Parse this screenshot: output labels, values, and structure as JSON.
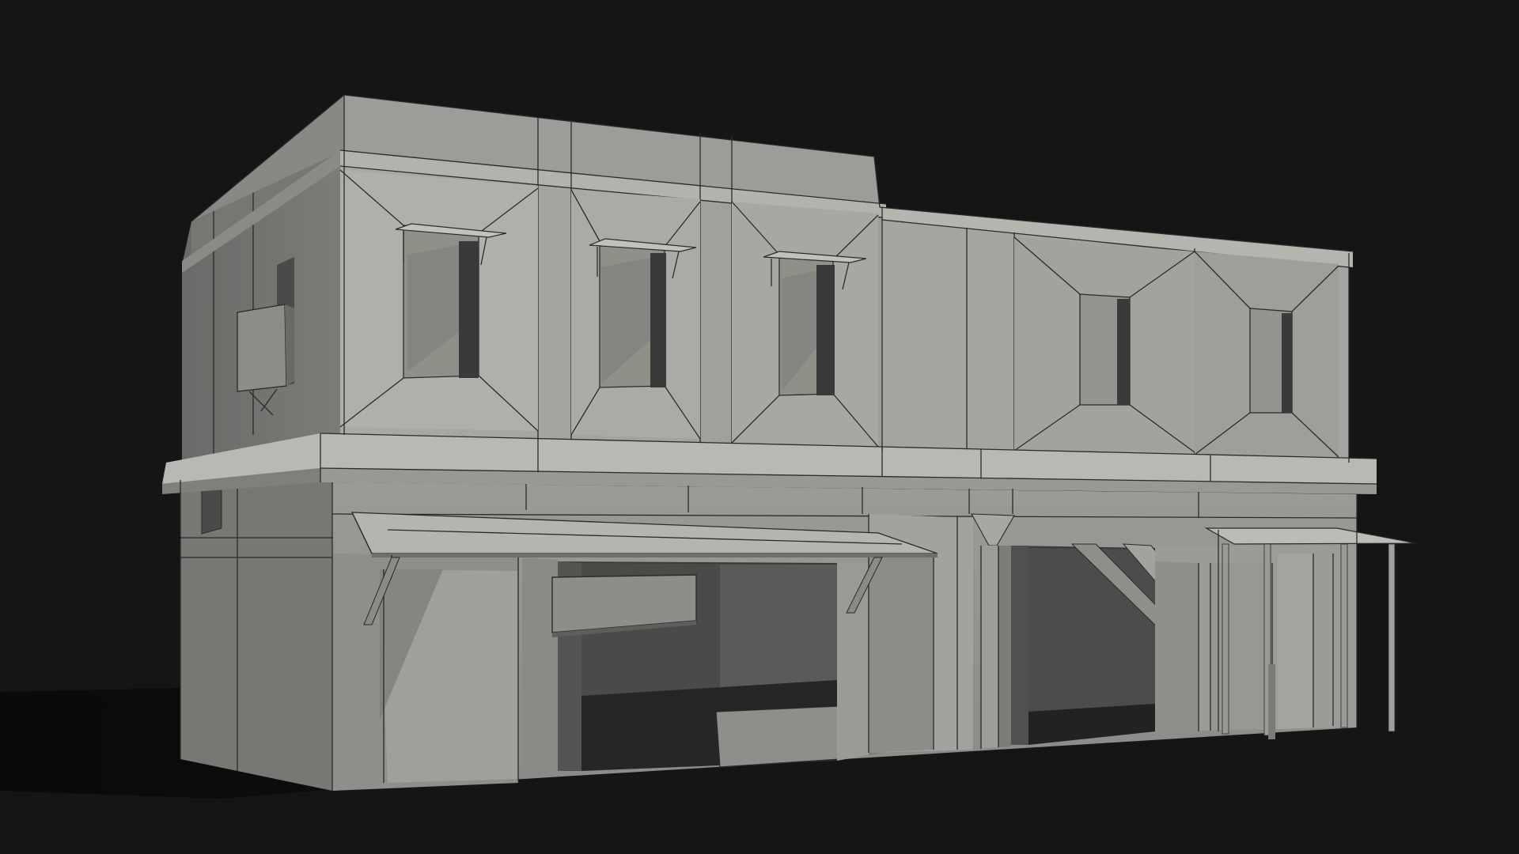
{
  "scene": {
    "subject": "clay-render-two-storey-building",
    "colors": {
      "background": "#151515",
      "wall_lit": "#a8a8a4",
      "wall_mid": "#8f8f8c",
      "wall_shade": "#6c6c6a",
      "wall_dark": "#4f4f4e",
      "opening": "#2e2e2e",
      "ground_shadow": "#0d0d0d",
      "edge": "#2a2a2a"
    }
  }
}
